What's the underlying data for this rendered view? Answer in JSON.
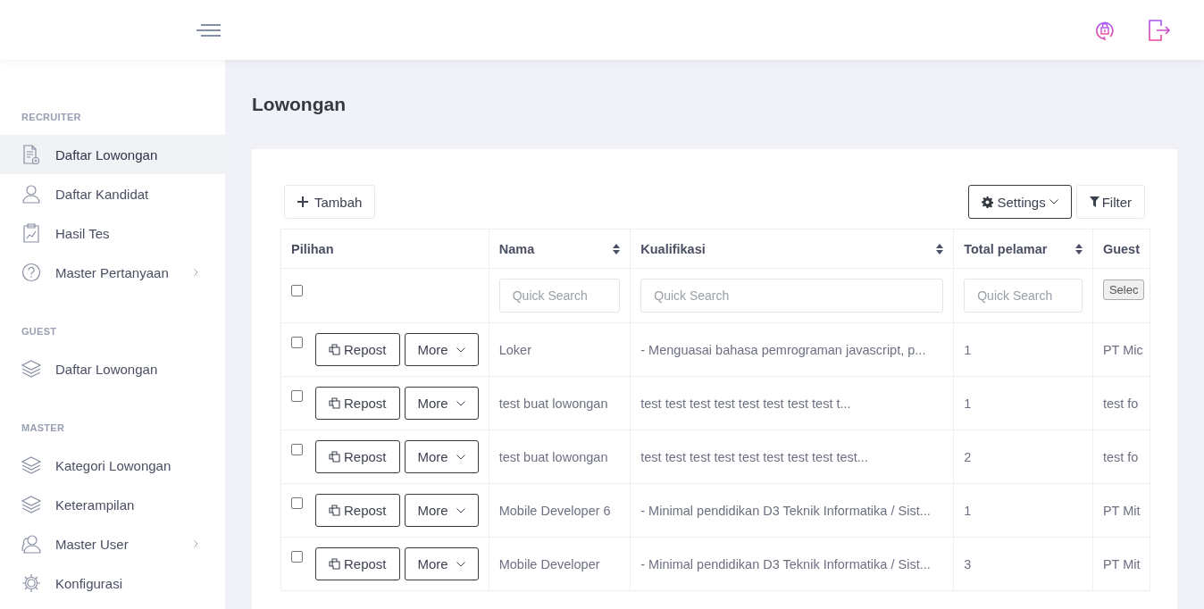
{
  "page_title": "Lowongan",
  "sidebar": [
    {
      "heading": "RECRUITER",
      "items": [
        {
          "label": "Daftar Lowongan",
          "kind": "document",
          "selected": true,
          "has_submenu": false
        },
        {
          "label": "Daftar Kandidat",
          "kind": "user",
          "selected": false,
          "has_submenu": false
        },
        {
          "label": "Hasil Tes",
          "kind": "clipboard",
          "selected": false,
          "has_submenu": false
        },
        {
          "label": "Master Pertanyaan",
          "kind": "question",
          "selected": false,
          "has_submenu": true
        }
      ]
    },
    {
      "heading": "GUEST",
      "items": [
        {
          "label": "Daftar Lowongan",
          "kind": "layers",
          "selected": false,
          "has_submenu": false
        }
      ]
    },
    {
      "heading": "MASTER",
      "items": [
        {
          "label": "Kategori Lowongan",
          "kind": "layers",
          "selected": false,
          "has_submenu": false
        },
        {
          "label": "Keterampilan",
          "kind": "layers",
          "selected": false,
          "has_submenu": false
        },
        {
          "label": "Master User",
          "kind": "users",
          "selected": false,
          "has_submenu": true
        },
        {
          "label": "Konfigurasi",
          "kind": "gear",
          "selected": false,
          "has_submenu": false
        }
      ]
    }
  ],
  "toolbar": {
    "add_button": "Tambah",
    "settings_button": "Settings",
    "filter_button": "Filter"
  },
  "table": {
    "columns": [
      {
        "label": "Pilihan",
        "sortable": false
      },
      {
        "label": "Nama",
        "sortable": true
      },
      {
        "label": "Kualifikasi",
        "sortable": true
      },
      {
        "label": "Total pelamar",
        "sortable": true
      },
      {
        "label": "Guest",
        "sortable": false
      }
    ],
    "filters": [
      {
        "kind": "checkbox",
        "checked": false
      },
      {
        "kind": "search",
        "placeholder": "Quick Search"
      },
      {
        "kind": "search",
        "placeholder": "Quick Search"
      },
      {
        "kind": "search",
        "placeholder": "Quick Search"
      },
      {
        "kind": "select",
        "value": "Selec"
      }
    ],
    "rows": [
      {
        "pilihan": {
          "checked": false,
          "repost": "Repost",
          "more": "More"
        },
        "nama": "Loker",
        "kualifikasi": "- Menguasai bahasa pemrograman javascript, p...",
        "total_pelamar": "1",
        "guest": "PT Mic"
      },
      {
        "pilihan": {
          "checked": false,
          "repost": "Repost",
          "more": "More"
        },
        "nama": "test buat lowongan",
        "kualifikasi": "test test test test test test test test t...",
        "total_pelamar": "1",
        "guest": "test fo"
      },
      {
        "pilihan": {
          "checked": false,
          "repost": "Repost",
          "more": "More"
        },
        "nama": "test buat lowongan",
        "kualifikasi": "test test test test test test test test test...",
        "total_pelamar": "2",
        "guest": "test fo"
      },
      {
        "pilihan": {
          "checked": false,
          "repost": "Repost",
          "more": "More"
        },
        "nama": "Mobile Developer 6",
        "kualifikasi": "- Minimal pendidikan D3 Teknik Informatika / Sist...",
        "total_pelamar": "1",
        "guest": "PT Mit"
      },
      {
        "pilihan": {
          "checked": false,
          "repost": "Repost",
          "more": "More"
        },
        "nama": "Mobile Developer",
        "kualifikasi": "- Minimal pendidikan D3 Teknik Informatika / Sist...",
        "total_pelamar": "3",
        "guest": "PT Mit"
      }
    ]
  }
}
